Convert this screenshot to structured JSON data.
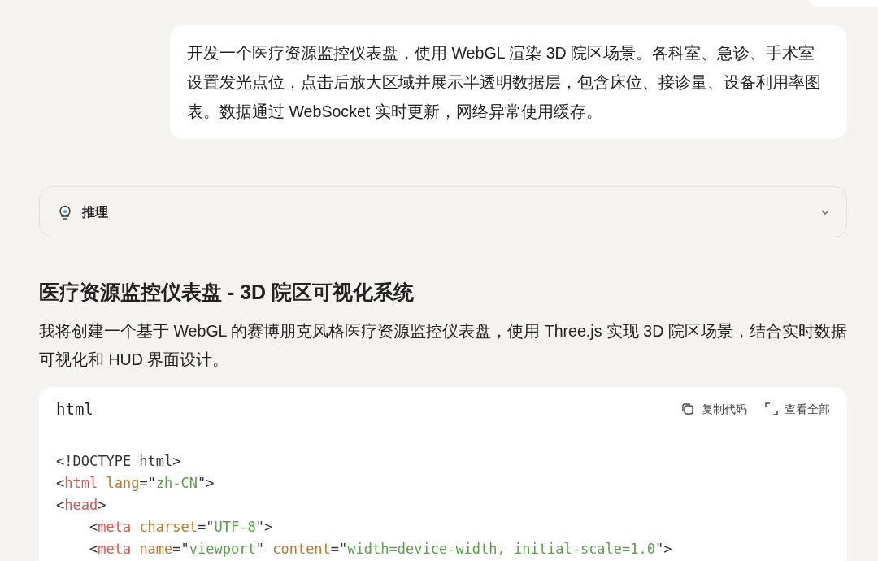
{
  "user_message": {
    "text": "开发一个医疗资源监控仪表盘，使用 WebGL 渲染 3D 院区场景。各科室、急诊、手术室设置发光点位，点击后放大区域并展示半透明数据层，包含床位、接诊量、设备利用率图表。数据通过 WebSocket 实时更新，网络异常使用缓存。"
  },
  "reasoning": {
    "label": "推理",
    "expanded": false
  },
  "answer": {
    "title": "医疗资源监控仪表盘 - 3D 院区可视化系统",
    "paragraph": "我将创建一个基于 WebGL 的赛博朋克风格医疗资源监控仪表盘，使用 Three.js 实现 3D 院区场景，结合实时数据可视化和 HUD 界面设计。"
  },
  "code_block": {
    "language": "html",
    "actions": [
      {
        "kind": "copy",
        "label": "复制代码"
      },
      {
        "kind": "expand",
        "label": "查看全部"
      }
    ],
    "lines": [
      [
        {
          "kind": "plain",
          "text": "<!DOCTYPE html>"
        }
      ],
      [
        {
          "kind": "plain",
          "text": "<"
        },
        {
          "kind": "tag",
          "text": "html"
        },
        {
          "kind": "attr",
          "text": " lang"
        },
        {
          "kind": "plain",
          "text": "=\""
        },
        {
          "kind": "string",
          "text": "zh-CN"
        },
        {
          "kind": "plain",
          "text": "\">"
        }
      ],
      [
        {
          "kind": "plain",
          "text": "<"
        },
        {
          "kind": "tag",
          "text": "head"
        },
        {
          "kind": "plain",
          "text": ">"
        }
      ],
      [
        {
          "kind": "plain",
          "text": "    <"
        },
        {
          "kind": "tag",
          "text": "meta"
        },
        {
          "kind": "attr",
          "text": " charset"
        },
        {
          "kind": "plain",
          "text": "=\""
        },
        {
          "kind": "string",
          "text": "UTF-8"
        },
        {
          "kind": "plain",
          "text": "\">"
        }
      ],
      [
        {
          "kind": "plain",
          "text": "    <"
        },
        {
          "kind": "tag",
          "text": "meta"
        },
        {
          "kind": "attr",
          "text": " name"
        },
        {
          "kind": "plain",
          "text": "=\""
        },
        {
          "kind": "string",
          "text": "viewport"
        },
        {
          "kind": "plain",
          "text": "\" "
        },
        {
          "kind": "attr",
          "text": "content"
        },
        {
          "kind": "plain",
          "text": "=\""
        },
        {
          "kind": "string",
          "text": "width=device-width, initial-scale=1.0"
        },
        {
          "kind": "plain",
          "text": "\">"
        }
      ]
    ]
  }
}
